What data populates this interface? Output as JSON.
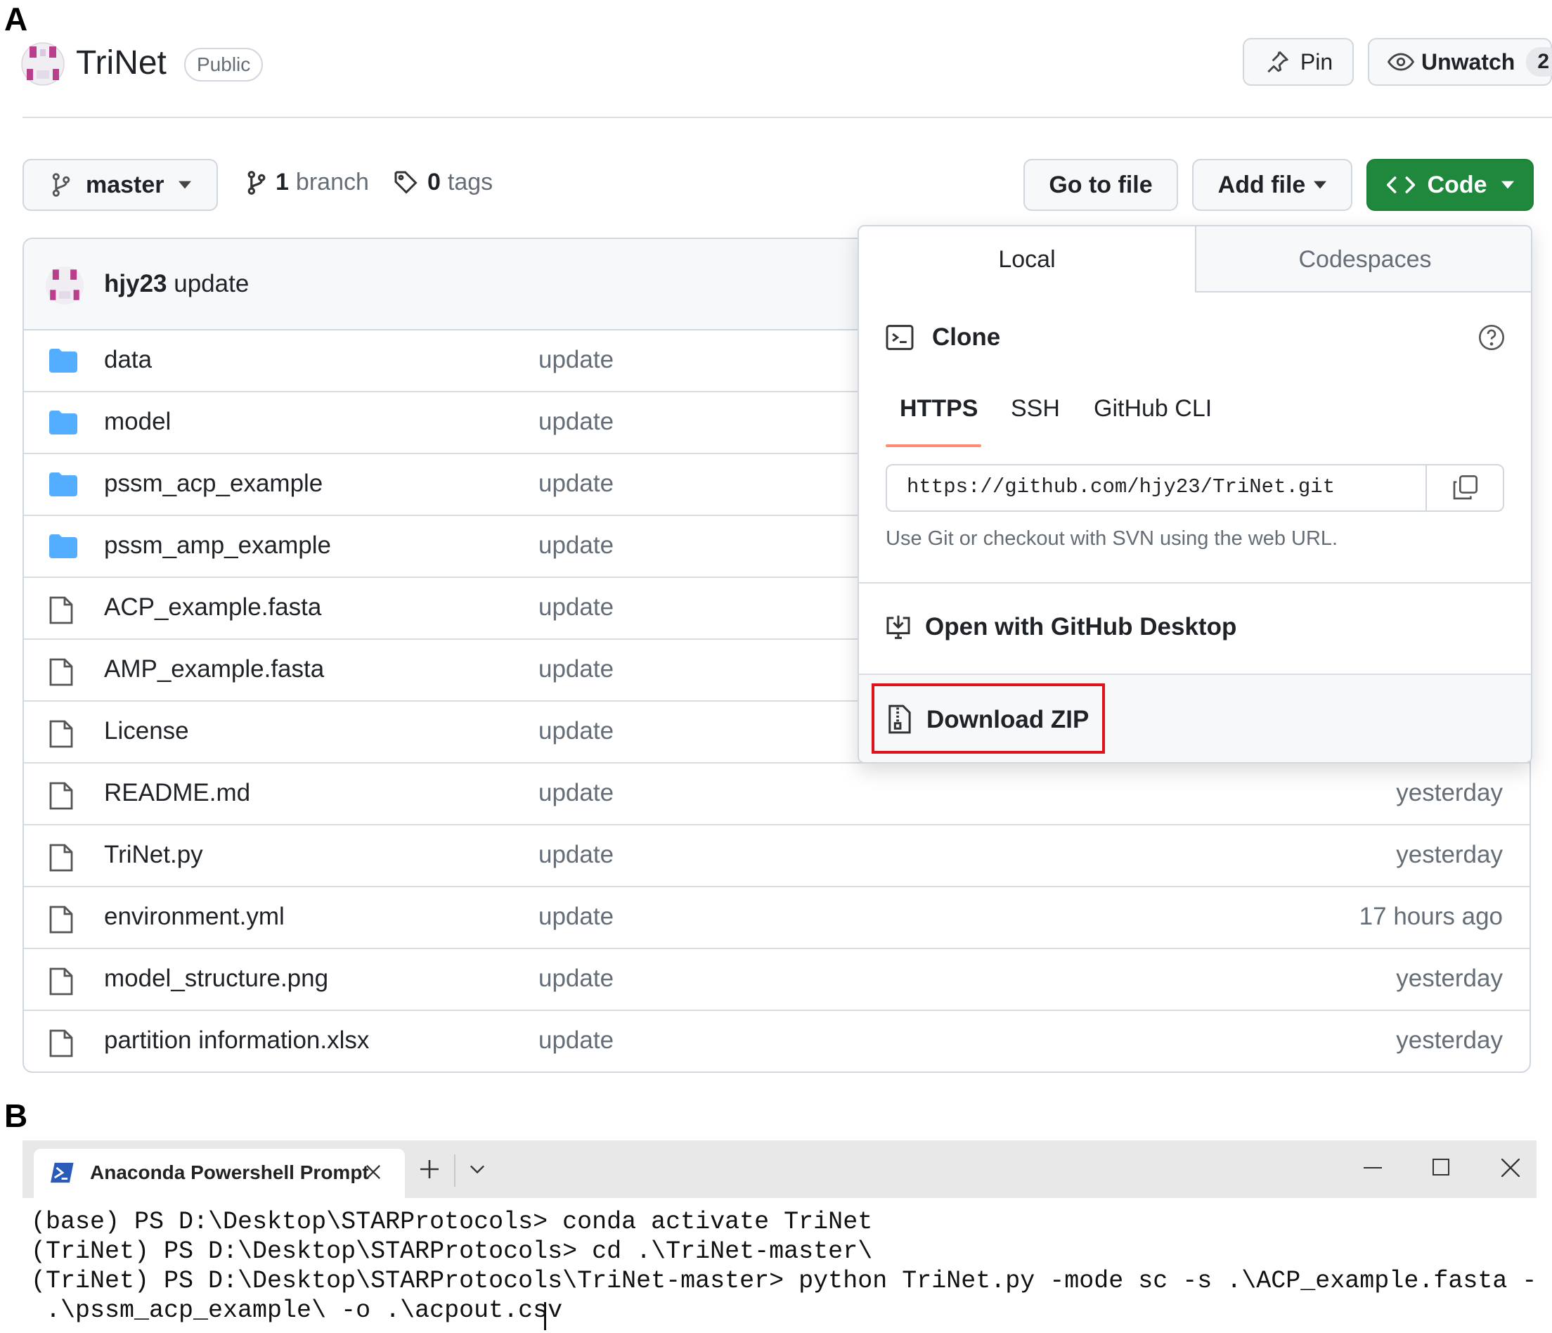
{
  "panel_labels": {
    "a": "A",
    "b": "B"
  },
  "repo": {
    "name": "TriNet",
    "visibility": "Public",
    "pin_label": "Pin",
    "unwatch_label": "Unwatch",
    "watch_count": "2"
  },
  "toolbar": {
    "branch": "master",
    "branch_count": "1",
    "branch_word": "branch",
    "tag_count": "0",
    "tag_word": "tags",
    "go_to_file": "Go to file",
    "add_file": "Add file",
    "code": "Code"
  },
  "commit": {
    "author": "hjy23",
    "message": "update"
  },
  "files": [
    {
      "name": "data",
      "type": "folder",
      "message": "update",
      "time": ""
    },
    {
      "name": "model",
      "type": "folder",
      "message": "update",
      "time": ""
    },
    {
      "name": "pssm_acp_example",
      "type": "folder",
      "message": "update",
      "time": ""
    },
    {
      "name": "pssm_amp_example",
      "type": "folder",
      "message": "update",
      "time": ""
    },
    {
      "name": "ACP_example.fasta",
      "type": "file",
      "message": "update",
      "time": ""
    },
    {
      "name": "AMP_example.fasta",
      "type": "file",
      "message": "update",
      "time": ""
    },
    {
      "name": "License",
      "type": "file",
      "message": "update",
      "time": ""
    },
    {
      "name": "README.md",
      "type": "file",
      "message": "update",
      "time": "yesterday"
    },
    {
      "name": "TriNet.py",
      "type": "file",
      "message": "update",
      "time": "yesterday"
    },
    {
      "name": "environment.yml",
      "type": "file",
      "message": "update",
      "time": "17 hours ago"
    },
    {
      "name": "model_structure.png",
      "type": "file",
      "message": "update",
      "time": "yesterday"
    },
    {
      "name": "partition information.xlsx",
      "type": "file",
      "message": "update",
      "time": "yesterday"
    }
  ],
  "dropdown": {
    "tab_local": "Local",
    "tab_codespaces": "Codespaces",
    "clone_title": "Clone",
    "proto_https": "HTTPS",
    "proto_ssh": "SSH",
    "proto_cli": "GitHub CLI",
    "url": "https://github.com/hjy23/TriNet.git",
    "hint": "Use Git or checkout with SVN using the web URL.",
    "open_desktop": "Open with GitHub Desktop",
    "download_zip": "Download ZIP",
    "highlight_color": "#e0131b"
  },
  "terminal": {
    "tab_title": "Anaconda Powershell Prompt",
    "lines": [
      "(base) PS D:\\Desktop\\STARProtocols> conda activate TriNet",
      "(TriNet) PS D:\\Desktop\\STARProtocols> cd .\\TriNet-master\\",
      "(TriNet) PS D:\\Desktop\\STARProtocols\\TriNet-master> python TriNet.py -mode sc -s .\\ACP_example.fasta -p",
      " .\\pssm_acp_example\\ -o .\\acpout.csv"
    ]
  },
  "colors": {
    "code_button": "#1f883d",
    "folder": "#54aeff",
    "accent_underline": "#fd8c73",
    "muted_text": "#656d76"
  }
}
